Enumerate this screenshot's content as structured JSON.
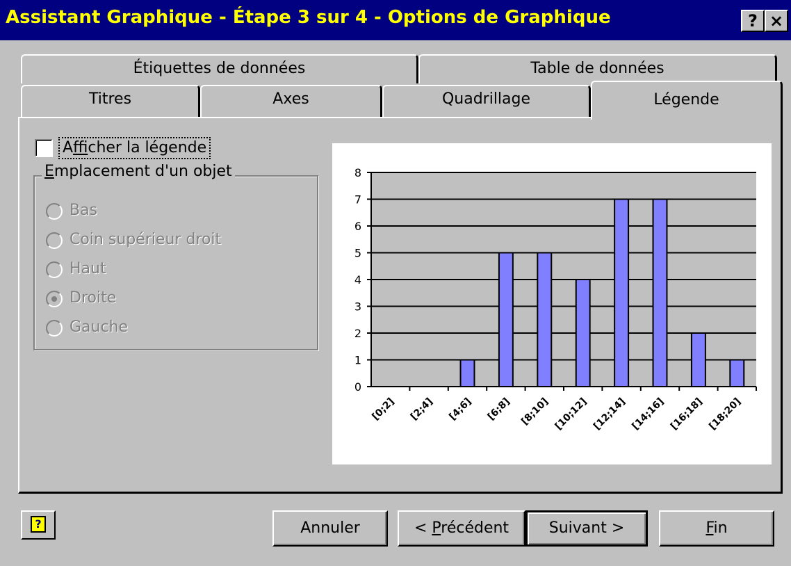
{
  "window": {
    "title": "Assistant Graphique - Étape 3 sur 4 - Options de Graphique",
    "help_glyph": "?",
    "close_glyph": "×"
  },
  "tabs": {
    "row1": [
      "Étiquettes de données",
      "Table de données"
    ],
    "row2": [
      "Titres",
      "Axes",
      "Quadrillage",
      "Légende"
    ],
    "active": "Légende"
  },
  "legend_options": {
    "show_legend_label_pre": "A",
    "show_legend_label_ul": "f",
    "show_legend_label_post": "ficher la légende",
    "show_legend_checked": false,
    "placement_title_ul": "E",
    "placement_title_post": "mplacement d'un objet",
    "placements": [
      "Bas",
      "Coin supérieur droit",
      "Haut",
      "Droite",
      "Gauche"
    ],
    "selected_placement": "Droite",
    "placements_enabled": false
  },
  "chart_data": {
    "type": "bar",
    "categories": [
      "[0;2]",
      "[2;4]",
      "[4;6]",
      "[6;8]",
      "[8;10]",
      "[10;12]",
      "[12;14]",
      "[14;16]",
      "[16;18]",
      "[18;20]"
    ],
    "values": [
      0,
      0,
      1,
      5,
      5,
      4,
      7,
      7,
      2,
      1
    ],
    "ylim": [
      0,
      8
    ],
    "yticks": [
      0,
      1,
      2,
      3,
      4,
      5,
      6,
      7,
      8
    ],
    "grid": true,
    "bar_color": "#8080ff",
    "plot_bg": "#c0c0c0",
    "title": "",
    "xlabel": "",
    "ylabel": ""
  },
  "buttons": {
    "help_glyph": "?",
    "cancel": "Annuler",
    "back_pre": "< ",
    "back_ul": "P",
    "back_post": "récédent",
    "next": "Suivant >",
    "finish_ul": "F",
    "finish_post": "in"
  }
}
